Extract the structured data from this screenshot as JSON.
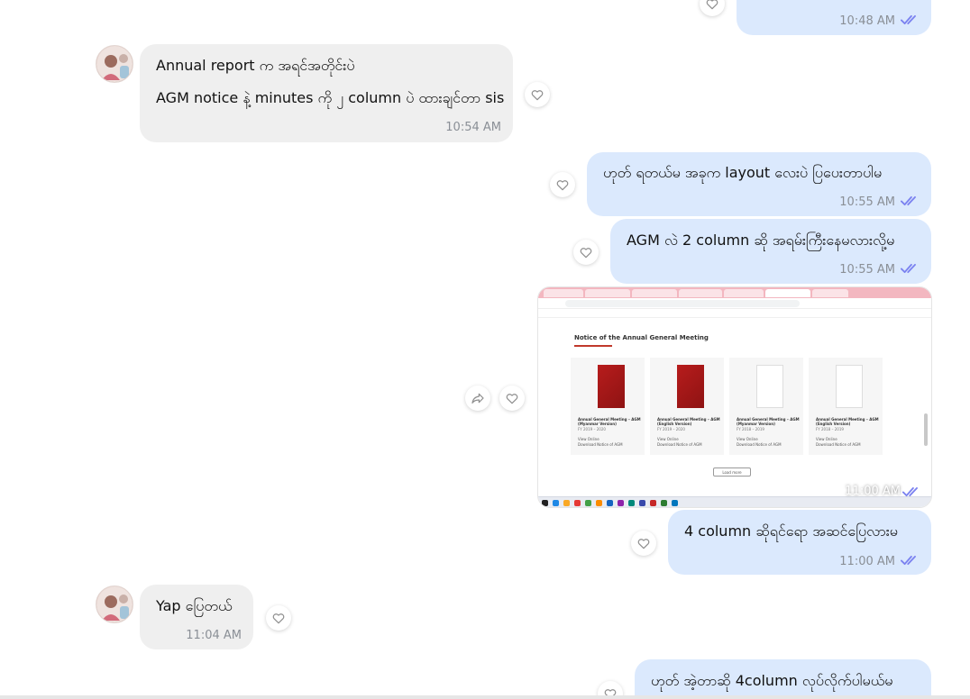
{
  "colors": {
    "outgoing_bubble": "#dbe9fd",
    "incoming_bubble": "#efefef",
    "read_ticks": "#7b82f0",
    "timestamp": "#8a8f96"
  },
  "icons": {
    "read": "double-check-icon",
    "react": "heart-outline-icon",
    "forward": "forward-arrow-icon"
  },
  "messages": {
    "m0": {
      "text": "",
      "time": "10:48 AM"
    },
    "m1": {
      "line1": "Annual report က အရင်အတိုင်းပဲ",
      "line2": "AGM notice နဲ့ minutes ကို ၂ column ပဲ ထားချင်တာ sis",
      "time": "10:54 AM"
    },
    "m2": {
      "text": "ဟုတ် ရတယ်မ အခုက layout လေးပဲ ပြပေးတာပါမ",
      "time": "10:55 AM"
    },
    "m3": {
      "text": "AGM လဲ 2 column ဆို အရမ်းကြီးနေမလားလို့မ",
      "time": "10:55 AM"
    },
    "m4": {
      "time": "11:00 AM",
      "screenshot": {
        "page_title": "Notice of the Annual General Meeting",
        "cards": [
          {
            "title": "Annual General Meeting – AGM (Myanmar Version)",
            "fy": "FY 2019 – 2020",
            "link1": "View Online",
            "link2": "Download Notice of AGM"
          },
          {
            "title": "Annual General Meeting – AGM (English Version)",
            "fy": "FY 2019 – 2020",
            "link1": "View Online",
            "link2": "Download Notice of AGM"
          },
          {
            "title": "Annual General Meeting – AGM (Myanmar Version)",
            "fy": "FY 2018 – 2019",
            "link1": "View Online",
            "link2": "Download Notice of AGM"
          },
          {
            "title": "Annual General Meeting – AGM (English Version)",
            "fy": "FY 2018 – 2019",
            "link1": "View Online",
            "link2": "Download Notice of AGM"
          }
        ],
        "load_more": "Load more"
      }
    },
    "m5": {
      "text": "4 column ဆိုရင်ရော အဆင်ပြေလားမ",
      "time": "11:00 AM"
    },
    "m6": {
      "text": "Yap ပြေတယ်",
      "time": "11:04 AM"
    },
    "m7": {
      "text": "ဟုတ် အဲ့တာဆို 4column လုပ်လိုက်ပါမယ်မ"
    }
  }
}
